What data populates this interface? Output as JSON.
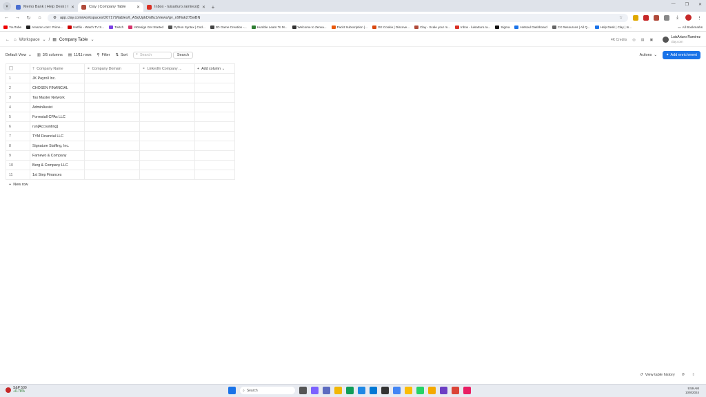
{
  "browser": {
    "tabs": [
      {
        "title": "Memo Bank | Help Desk | Clay",
        "color": "#4a6fd1"
      },
      {
        "title": "Clay | Company Table",
        "color": "#b04a3a"
      },
      {
        "title": "Inbox - luisarturo.ramirez@cla...",
        "color": "#d93025"
      }
    ],
    "url": "app.clay.com/workspaces/207179/tables/t_ASqUpkDntfu1/views/gv_n9Nuk275wBN",
    "bookmarks": [
      "YouTube",
      "Amazon.com: Prime...",
      "Netflix - Watch TV S...",
      "Twitch",
      "InDesign Get Started",
      "Python Syntax | Cod...",
      "2D Game Creation -...",
      "Humble Learn To M...",
      "Welcome to Zenva...",
      "Packt Subscription |...",
      "GE Cookie | Discove...",
      "Clay - Scale your m...",
      "Inbox - luisarturo.ra...",
      "Sigma",
      "Hetsoul Dashboard",
      "CX Resources | All Q...",
      "Help Desk | Clay | In..."
    ],
    "all_bookmarks": "All Bookmarks"
  },
  "app": {
    "workspace": "Workspace",
    "table_name": "Company Table",
    "credits": "4K Credits",
    "user_name": "LuisArturo Ramirez",
    "user_org": "clay.com"
  },
  "toolbar": {
    "view": "Default View",
    "columns": "3/5 columns",
    "rows": "11/11 rows",
    "filter": "Filter",
    "sort": "Sort",
    "search_placeholder": "Search",
    "search_button": "Search",
    "actions": "Actions",
    "add_enrichment": "Add enrichment"
  },
  "table": {
    "headers": [
      "Company Name",
      "Company Domain",
      "LinkedIn Company ...",
      "Add column"
    ],
    "rows": [
      {
        "n": "1",
        "name": "JK Payroll Inc."
      },
      {
        "n": "2",
        "name": "CHOSEN FINANCIAL"
      },
      {
        "n": "3",
        "name": "Tax Master Network"
      },
      {
        "n": "4",
        "name": "AdminAssist"
      },
      {
        "n": "5",
        "name": "Forrestall CPAs LLC"
      },
      {
        "n": "6",
        "name": "run[Accounting]"
      },
      {
        "n": "7",
        "name": "TYM Financial LLC"
      },
      {
        "n": "8",
        "name": "Signature Staffing, Inc."
      },
      {
        "n": "9",
        "name": "Famewo & Company"
      },
      {
        "n": "10",
        "name": "Berg & Company LLC"
      },
      {
        "n": "11",
        "name": "1st Step Finances"
      }
    ],
    "new_row": "New row"
  },
  "footer": {
    "view_history": "View table history"
  },
  "taskbar": {
    "stock_name": "S&P 500",
    "stock_change": "+0.78%",
    "search": "Search",
    "time": "9:59 AM",
    "date": "10/8/2024"
  }
}
